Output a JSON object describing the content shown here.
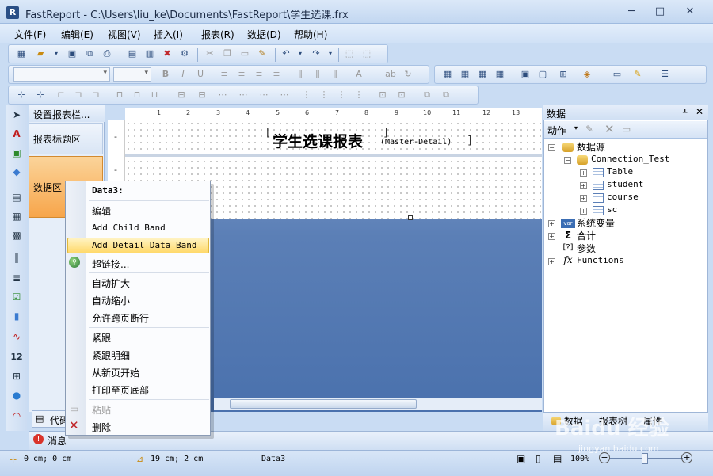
{
  "window": {
    "title": "FastReport - C:\\Users\\liu_ke\\Documents\\FastReport\\学生选课.frx",
    "app_icon_letter": "R",
    "minimize": "─",
    "maximize": "□",
    "close": "✕"
  },
  "menu": [
    "文件(F)",
    "编辑(E)",
    "视图(V)",
    "插入(I)",
    "报表(R)",
    "数据(D)",
    "帮助(H)"
  ],
  "bands": {
    "header": "设置报表栏...",
    "report_title": "报表标题区",
    "data": "数据区"
  },
  "canvas": {
    "ruler_numbers": [
      "1",
      "2",
      "3",
      "4",
      "5",
      "6",
      "7",
      "8",
      "9",
      "10",
      "11",
      "12",
      "13"
    ],
    "gutter_marks": [
      "-",
      "-"
    ],
    "report_title": "学生选课报表",
    "master_detail": "(Master-Detail)"
  },
  "context_menu": {
    "title": "Data3:",
    "items": {
      "edit": "编辑",
      "add_child_band": "Add Child Band",
      "add_detail_band": "Add Detail Data Band",
      "hyperlink": "超链接...",
      "auto_grow": "自动扩大",
      "auto_shrink": "自动缩小",
      "allow_split": "允许跨页断行",
      "keep_with": "紧跟",
      "keep_detail": "紧跟明细",
      "new_page": "从新页开始",
      "print_bottom": "打印至页底部",
      "paste": "粘贴",
      "delete": "删除"
    }
  },
  "bottom_tabs": {
    "code": "代码",
    "messages": "消息"
  },
  "data_panel": {
    "title": "数据",
    "pin": "ᚆ",
    "close": "✕",
    "action": "动作",
    "tree": {
      "datasource": "数据源",
      "connection": "Connection_Test",
      "tables": [
        "Table",
        "student",
        "course",
        "sc"
      ],
      "system_vars": "系统变量",
      "totals": "合计",
      "parameters": "参数",
      "functions": "Functions"
    },
    "tabs": [
      "数据",
      "报表树",
      "属性"
    ]
  },
  "statusbar": {
    "position": "0 cm; 0 cm",
    "size": "19 cm; 2 cm",
    "object": "Data3",
    "zoom": "100%"
  },
  "watermark": {
    "brand": "Baidu 经验",
    "url": "jingyan.baidu.com"
  },
  "colors": {
    "accent_orange": "#f7a54a",
    "highlight": "#ffd96b",
    "frame_blue": "#c9dcf3"
  }
}
